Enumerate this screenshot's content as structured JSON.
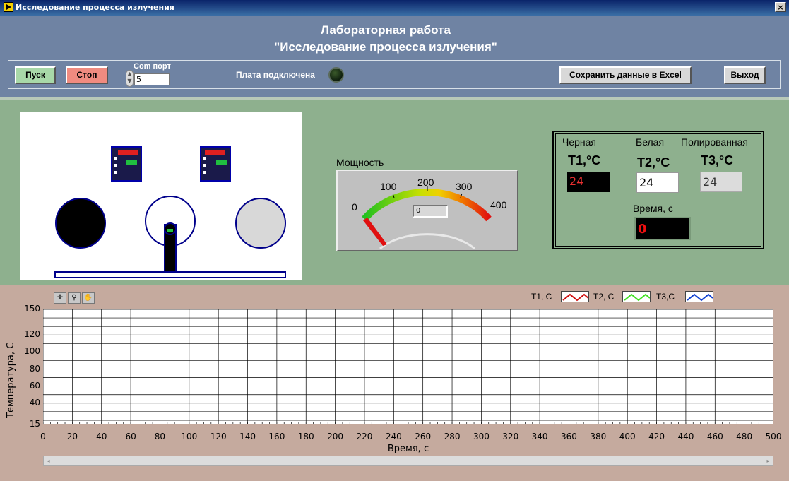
{
  "window": {
    "title": "Исследование процесса излучения",
    "close_label": "×"
  },
  "header": {
    "title_line1": "Лабораторная работа",
    "title_line2": "\"Исследование процесса излучения\""
  },
  "controls": {
    "start_label": "Пуск",
    "stop_label": "Стоп",
    "com_port_label": "Com порт",
    "com_port_value": "5",
    "board_label": "Плата подключена",
    "save_label": "Сохранить данные в Excel",
    "exit_label": "Выход"
  },
  "gauge": {
    "label": "Мощность",
    "ticks": [
      "0",
      "100",
      "200",
      "300",
      "400"
    ],
    "value": "0",
    "min": 0,
    "max": 400
  },
  "temps": {
    "black_label": "Черная",
    "white_label": "Белая",
    "polished_label": "Полированная",
    "t1_label": "Т1,°С",
    "t2_label": "Т2,°С",
    "t3_label": "Т3,°С",
    "t1_value": "24",
    "t2_value": "24",
    "t3_value": "24",
    "time_label": "Время, с",
    "time_value": "0"
  },
  "chart_data": {
    "type": "line",
    "ylabel": "Температура, С",
    "xlabel": "Время, с",
    "xlim": [
      0,
      500
    ],
    "ylim": [
      15,
      150
    ],
    "x_ticks": [
      "0",
      "20",
      "40",
      "60",
      "80",
      "100",
      "120",
      "140",
      "160",
      "180",
      "200",
      "220",
      "240",
      "260",
      "280",
      "300",
      "320",
      "340",
      "360",
      "380",
      "400",
      "420",
      "440",
      "460",
      "480",
      "500"
    ],
    "y_ticks": [
      "15",
      "40",
      "60",
      "80",
      "100",
      "120",
      "150"
    ],
    "grid": true,
    "legend_position": "top-right",
    "series": [
      {
        "name": "T1, C",
        "color": "#d01010",
        "values": []
      },
      {
        "name": "T2, C",
        "color": "#40e020",
        "values": []
      },
      {
        "name": "T3,C",
        "color": "#1040d0",
        "values": []
      }
    ]
  }
}
